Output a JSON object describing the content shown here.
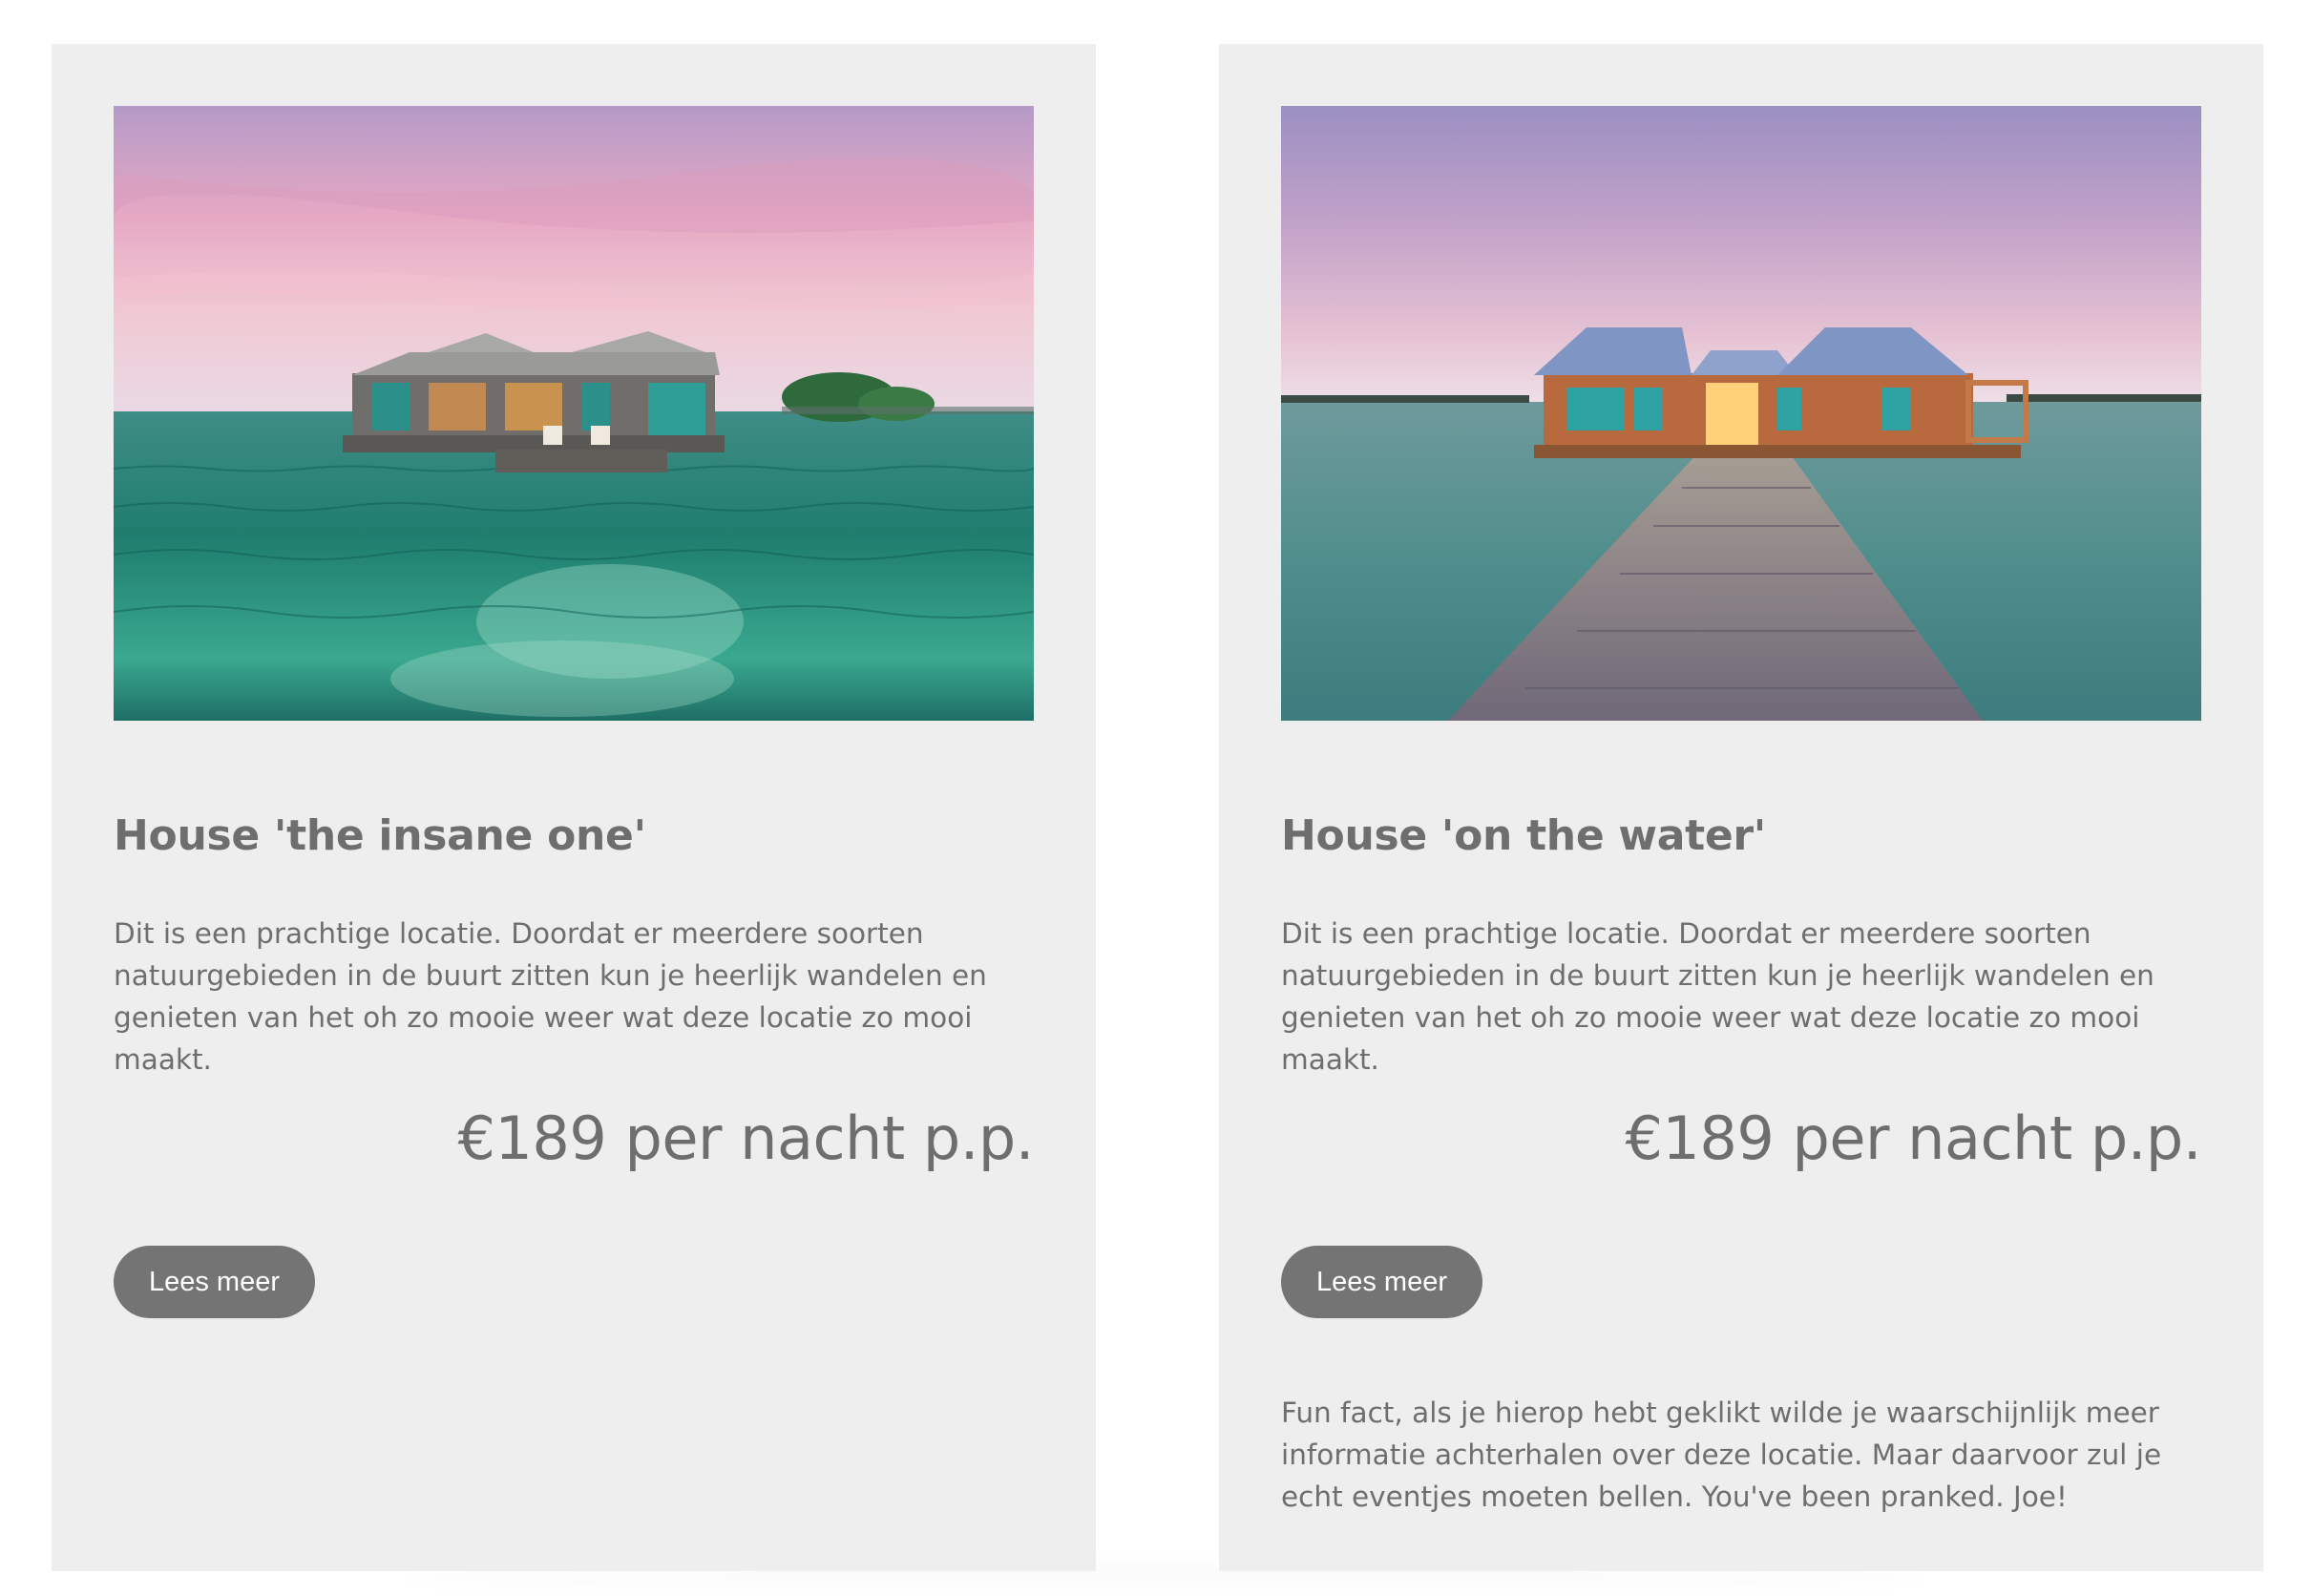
{
  "cards": [
    {
      "image_alt": "House 'the insane one'",
      "title": "House 'the insane one'",
      "description": "Dit is een prachtige locatie. Doordat er meerdere soorten natuurgebieden in de buurt zitten kun je heerlijk wandelen en genieten van het oh zo mooie weer wat deze locatie zo mooi maakt.",
      "price": "€189 per nacht p.p.",
      "button_label": "Lees meer"
    },
    {
      "image_alt": "House 'on the water'",
      "title": "House 'on the water'",
      "description": "Dit is een prachtige locatie. Doordat er meerdere soorten natuurgebieden in de buurt zitten kun je heerlijk wandelen en genieten van het oh zo mooie weer wat deze locatie zo mooi maakt.",
      "price": "€189 per nacht p.p.",
      "button_label": "Lees meer",
      "fun_fact": "Fun fact, als je hierop hebt geklikt wilde je waarschijnlijk meer informatie achterhalen over deze locatie. Maar daarvoor zul je echt eventjes moeten bellen. You've been pranked. Joe!"
    }
  ],
  "colors": {
    "card_background": "#eeeeee",
    "text": "#6e6e6e",
    "button_background": "#747474",
    "button_text": "#ffffff"
  }
}
